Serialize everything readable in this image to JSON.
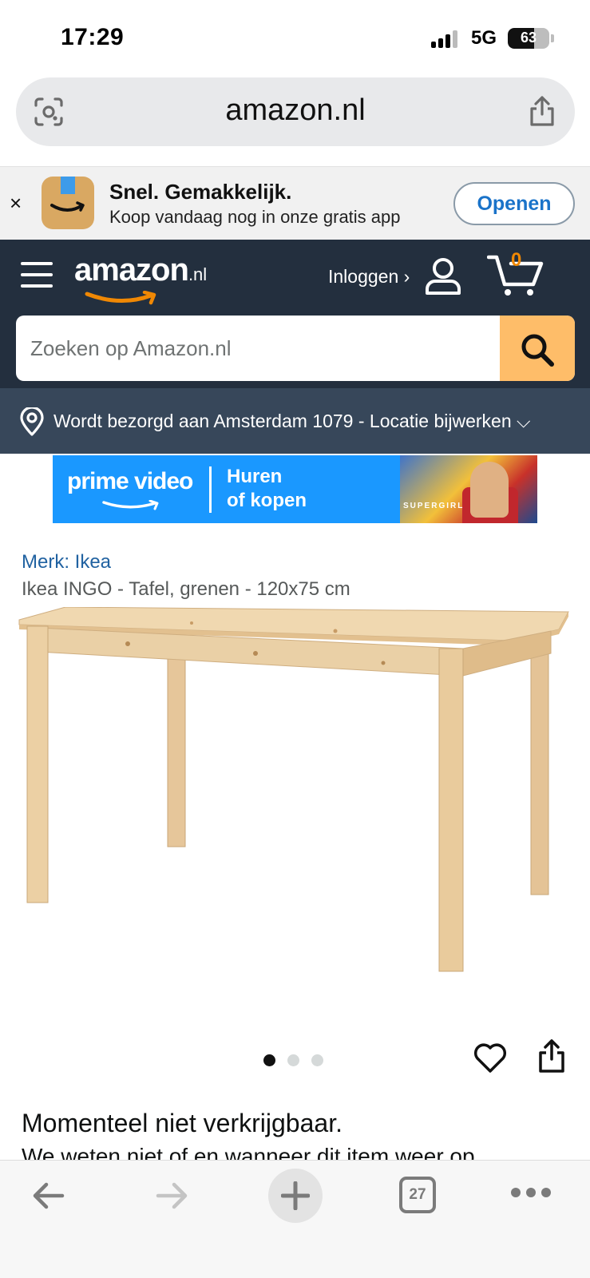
{
  "status_bar": {
    "time": "17:29",
    "network": "5G",
    "battery": "63",
    "battery_level": 0.63
  },
  "browser": {
    "url": "amazon.nl"
  },
  "app_banner": {
    "close": "×",
    "title": "Snel. Gemakkelijk.",
    "subtitle": "Koop vandaag nog in onze gratis app",
    "open_label": "Openen"
  },
  "header": {
    "logo_text": "amazon",
    "logo_tld": ".nl",
    "login_label": "Inloggen ›",
    "cart_count": "0",
    "search_placeholder": "Zoeken op Amazon.nl"
  },
  "location": {
    "text": "Wordt bezorgd aan Amsterdam 1079 - Locatie bijwerken ⌵"
  },
  "prime_banner": {
    "logo": "prime video",
    "cta_line1": "Huren",
    "cta_line2": "of kopen",
    "art_caption": "SUPERGIRL"
  },
  "product": {
    "brand_link": "Merk: Ikea",
    "title": "Ikea INGO - Tafel, grenen - 120x75 cm",
    "image_count": 3,
    "active_image": 1,
    "availability": "Momenteel niet verkrijgbaar.",
    "availability_detail": "We weten niet of en wanneer dit item weer op"
  },
  "toolbar": {
    "tab_count": "27"
  },
  "colors": {
    "header_bg": "#232f3e",
    "location_bg": "#37475a",
    "search_button": "#febd69",
    "link_blue": "#2162a1",
    "cart_orange": "#f08804",
    "prime_blue": "#1a98ff"
  },
  "icons": [
    "lens-icon",
    "share-icon",
    "close-icon",
    "amazon-app-icon",
    "hamburger-icon",
    "user-icon",
    "cart-icon",
    "search-icon",
    "location-pin-icon",
    "heart-icon",
    "share-icon",
    "back-arrow-icon",
    "forward-arrow-icon",
    "plus-icon",
    "tabs-icon",
    "more-icon"
  ]
}
